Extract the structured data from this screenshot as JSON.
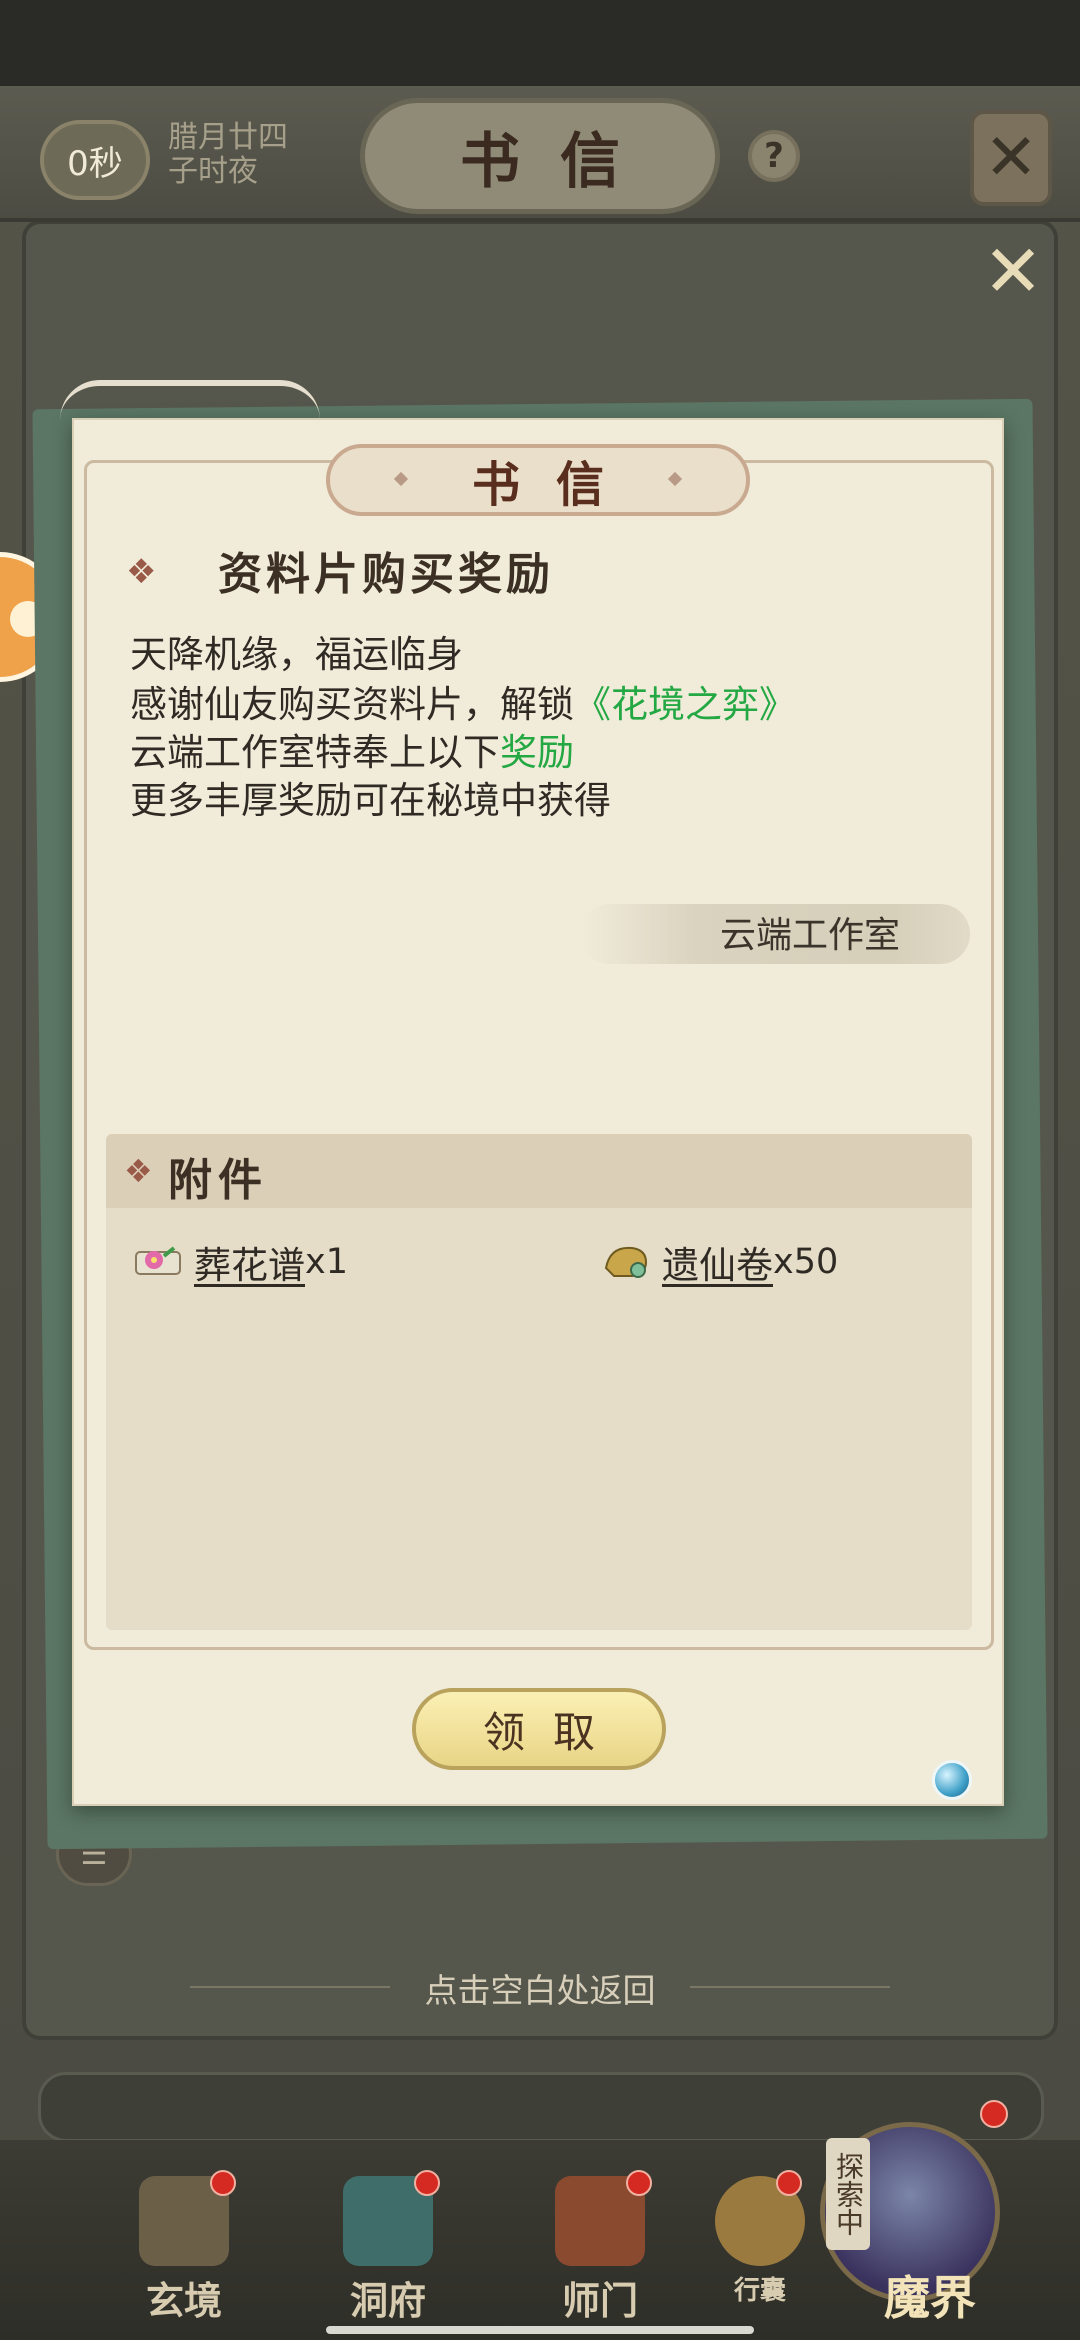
{
  "top_bar": {
    "timer": "0秒",
    "date_line1": "腊月廿四",
    "date_line2": "子时夜",
    "title": "书信",
    "help_symbol": "?",
    "close_symbol": "✕"
  },
  "dialog": {
    "close_symbol": "✕",
    "header": "书信",
    "subject_icon": "❖",
    "subject": "资料片购买奖励",
    "body": {
      "line1": "天降机缘，福运临身",
      "line2_prefix": "感谢仙友购买资料片，解锁",
      "line2_highlight": "《花境之弈》",
      "line3_prefix": "云端工作室特奉上以下",
      "line3_highlight": "奖励",
      "line4": "更多丰厚奖励可在秘境中获得"
    },
    "signature": "云端工作室",
    "attachments": {
      "icon": "❖",
      "title": "附件",
      "items": [
        {
          "name": "葬花谱",
          "qty": "x1",
          "icon": "flower-scroll-icon"
        },
        {
          "name": "遗仙卷",
          "qty": "x50",
          "icon": "golden-scroll-icon"
        }
      ]
    },
    "claim_label": "领取"
  },
  "return_hint": "点击空白处返回",
  "bottom_nav": {
    "items": [
      {
        "label": "玄境"
      },
      {
        "label": "洞府"
      },
      {
        "label": "师门"
      },
      {
        "label": "行囊"
      }
    ],
    "explore_tag": "探索中",
    "explore_label": "魔界"
  },
  "colors": {
    "highlight_green": "#24a844",
    "paper": "#f1ecda",
    "button_gold": "#fbf0b4",
    "badge_red": "#d52a22"
  }
}
